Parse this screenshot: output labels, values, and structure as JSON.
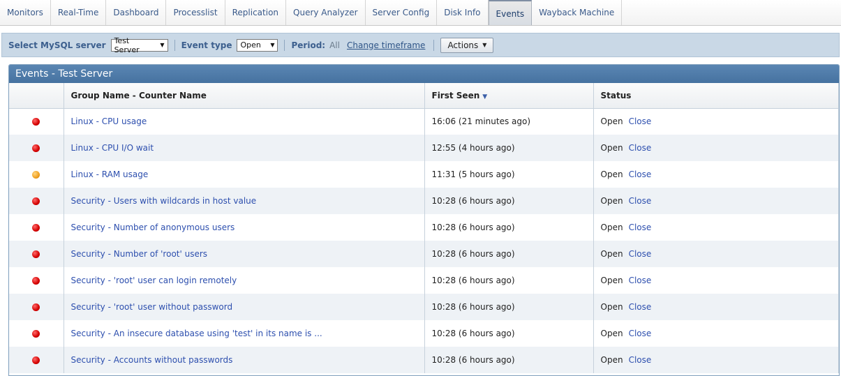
{
  "nav": {
    "tabs": [
      "Monitors",
      "Real-Time",
      "Dashboard",
      "Processlist",
      "Replication",
      "Query Analyzer",
      "Server Config",
      "Disk Info",
      "Events",
      "Wayback Machine"
    ],
    "active": "Events"
  },
  "filters": {
    "server_label": "Select MySQL server",
    "server_value": "Test Server",
    "event_type_label": "Event type",
    "event_type_value": "Open",
    "period_label": "Period:",
    "period_value": "All",
    "change_timeframe": "Change timeframe",
    "actions_label": "Actions"
  },
  "panel": {
    "title": "Events - Test Server",
    "columns": {
      "name": "Group Name - Counter Name",
      "first_seen": "First Seen",
      "status": "Status"
    },
    "rows": [
      {
        "severity": "red",
        "name": "Linux - CPU usage",
        "first_seen": "16:06 (21 minutes ago)",
        "status": "Open",
        "action": "Close"
      },
      {
        "severity": "red",
        "name": "Linux - CPU I/O wait",
        "first_seen": "12:55 (4 hours ago)",
        "status": "Open",
        "action": "Close"
      },
      {
        "severity": "orange",
        "name": "Linux - RAM usage",
        "first_seen": "11:31 (5 hours ago)",
        "status": "Open",
        "action": "Close"
      },
      {
        "severity": "red",
        "name": "Security - Users with wildcards in host value",
        "first_seen": "10:28 (6 hours ago)",
        "status": "Open",
        "action": "Close"
      },
      {
        "severity": "red",
        "name": "Security - Number of anonymous users",
        "first_seen": "10:28 (6 hours ago)",
        "status": "Open",
        "action": "Close"
      },
      {
        "severity": "red",
        "name": "Security - Number of 'root' users",
        "first_seen": "10:28 (6 hours ago)",
        "status": "Open",
        "action": "Close"
      },
      {
        "severity": "red",
        "name": "Security - 'root' user can login remotely",
        "first_seen": "10:28 (6 hours ago)",
        "status": "Open",
        "action": "Close"
      },
      {
        "severity": "red",
        "name": "Security - 'root' user without password",
        "first_seen": "10:28 (6 hours ago)",
        "status": "Open",
        "action": "Close"
      },
      {
        "severity": "red",
        "name": "Security - An insecure database using 'test' in its name is ...",
        "first_seen": "10:28 (6 hours ago)",
        "status": "Open",
        "action": "Close"
      },
      {
        "severity": "red",
        "name": "Security - Accounts without passwords",
        "first_seen": "10:28 (6 hours ago)",
        "status": "Open",
        "action": "Close"
      }
    ]
  },
  "colors": {
    "red": "#d40000",
    "orange": "#f0a020",
    "header_blue": "#4672a0",
    "filter_bg": "#c9d8e6"
  }
}
